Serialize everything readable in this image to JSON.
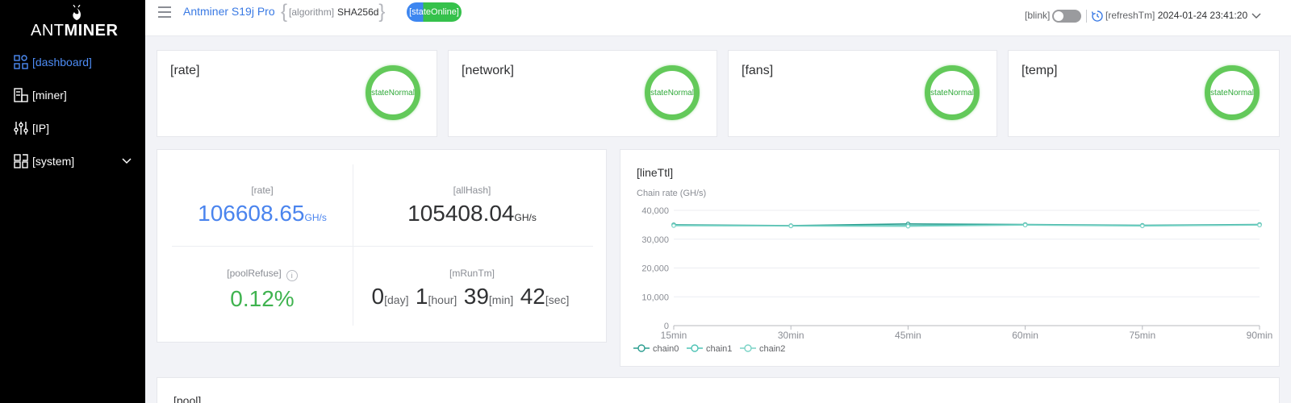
{
  "sidebar": {
    "logo": {
      "text_light": "ANT",
      "text_bold": "MINER"
    },
    "items": [
      {
        "label": "[dashboard]",
        "icon": "dashboard-icon",
        "active": true
      },
      {
        "label": "[miner]",
        "icon": "miner-icon",
        "active": false
      },
      {
        "label": "[IP]",
        "icon": "sliders-icon",
        "active": false
      },
      {
        "label": "[system]",
        "icon": "system-grid-icon",
        "active": false,
        "expandable": true
      }
    ]
  },
  "header": {
    "model": "Antminer S19j Pro",
    "algorithm_label": "[algorithm]",
    "algorithm_value": "SHA256d",
    "state": "[stateOnline]",
    "blink_label": "[blink]",
    "blink_on": false,
    "refresh_label": "[refreshTm]",
    "refresh_time": "2024-01-24 23:41:20"
  },
  "status_cards": [
    {
      "title": "[rate]",
      "state": "stateNormal"
    },
    {
      "title": "[network]",
      "state": "stateNormal"
    },
    {
      "title": "[fans]",
      "state": "stateNormal"
    },
    {
      "title": "[temp]",
      "state": "stateNormal"
    }
  ],
  "stats": {
    "rate": {
      "label": "[rate]",
      "value": "106608.65",
      "unit": "GH/s"
    },
    "all_hash": {
      "label": "[allHash]",
      "value": "105408.04",
      "unit": "GH/s"
    },
    "pool_refuse": {
      "label": "[poolRefuse]",
      "value": "0.12%"
    },
    "run_time": {
      "label": "[mRunTm]",
      "day": "0",
      "day_unit": "[day]",
      "hour": "1",
      "hour_unit": "[hour]",
      "min": "39",
      "min_unit": "[min]",
      "sec": "42",
      "sec_unit": "[sec]"
    }
  },
  "colors": {
    "accent_blue": "#4a84ee",
    "ok_green": "#63c95a",
    "chain0": "#2a9d8f",
    "chain1": "#4ec3b5",
    "chain2": "#7ad3c6"
  },
  "chart_data": {
    "type": "line",
    "title": "[lineTtl]",
    "ylabel": "Chain rate (GH/s)",
    "x": [
      "15min",
      "30min",
      "45min",
      "60min",
      "75min",
      "90min"
    ],
    "ylim": [
      0,
      40000
    ],
    "yticks": [
      "0",
      "10,000",
      "20,000",
      "30,000",
      "40,000"
    ],
    "grid": true,
    "legend": "bottom-left",
    "series": [
      {
        "name": "chain0",
        "values": [
          35000,
          34700,
          35300,
          35100,
          34800,
          35100
        ]
      },
      {
        "name": "chain1",
        "values": [
          34800,
          34600,
          34700,
          35000,
          34700,
          35000
        ]
      },
      {
        "name": "chain2",
        "values": [
          34700,
          34600,
          34500,
          34900,
          34600,
          34900
        ]
      }
    ]
  },
  "pool": {
    "title": "[pool]"
  }
}
